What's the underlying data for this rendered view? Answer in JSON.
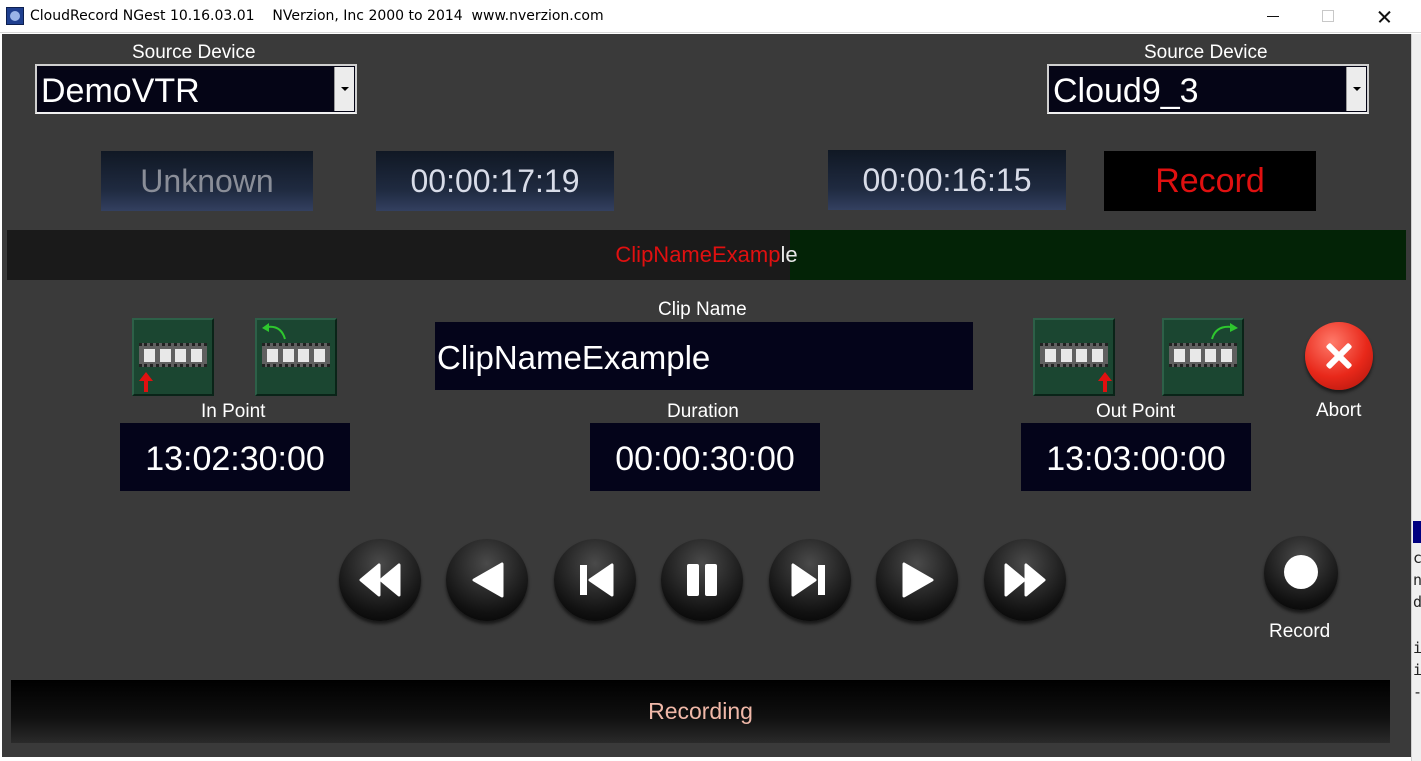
{
  "window": {
    "title": "CloudRecord NGest 10.16.03.01    NVerzion, Inc 2000 to 2014  www.nverzion.com"
  },
  "left_source": {
    "label": "Source Device",
    "value": "DemoVTR"
  },
  "right_source": {
    "label": "Source Device",
    "value": "Cloud9_3"
  },
  "left_panel": {
    "status": "Unknown",
    "timecode": "00:00:17:19"
  },
  "right_panel": {
    "timecode": "00:00:16:15",
    "status": "Record"
  },
  "progress": {
    "clip_text_red": "ClipNameExamp",
    "clip_text_tail": "le",
    "fill_fraction": 0.44
  },
  "clip_name": {
    "label": "Clip Name",
    "value": "ClipNameExample"
  },
  "in_point": {
    "label": "In Point",
    "value": "13:02:30:00"
  },
  "duration": {
    "label": "Duration",
    "value": "00:00:30:00"
  },
  "out_point": {
    "label": "Out Point",
    "value": "13:03:00:00"
  },
  "abort": {
    "label": "Abort"
  },
  "record": {
    "label": "Record"
  },
  "transport_icons": [
    "rewind-icon",
    "play-reverse-icon",
    "step-back-icon",
    "pause-icon",
    "step-forward-icon",
    "play-icon",
    "fast-forward-icon"
  ],
  "status_bar": {
    "text": "Recording"
  },
  "background_window_chars": [
    "c",
    "n",
    "d",
    "i",
    "i",
    "-"
  ],
  "colors": {
    "record_red": "#e01010",
    "status_text": "#f0b8a8",
    "field_bg": "#04041a",
    "progress_green": "#032306"
  }
}
